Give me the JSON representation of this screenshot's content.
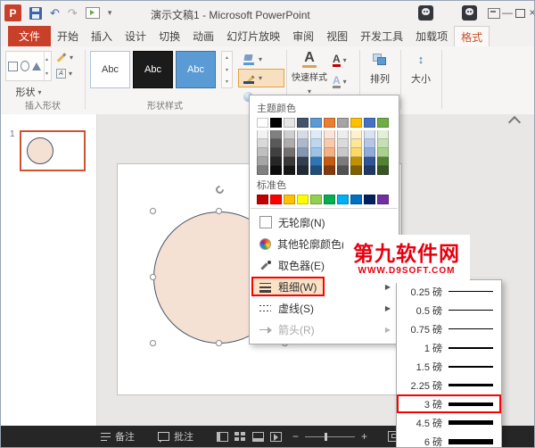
{
  "colors": {
    "file_tab": "#C8402A",
    "annotation": "#FF0000",
    "menu_highlight": "#FBE2C7",
    "circle_fill": "#F5E1D4",
    "circle_stroke": "#44546A",
    "watermark": "#E8000F"
  },
  "icons": {
    "pp_letter": "P",
    "undo": "↶",
    "redo": "↷",
    "dropdown": "▾",
    "submenu_arrow": "▶",
    "gallery_up": "▴",
    "gallery_down": "▾",
    "minimize": "—",
    "close": "×",
    "zoom_out": "−",
    "zoom_in": "+"
  },
  "titlebar": {
    "title": "演示文稿1 - Microsoft PowerPoint"
  },
  "ribbon": {
    "file_tab": "文件",
    "tabs": [
      "开始",
      "插入",
      "设计",
      "切换",
      "动画",
      "幻灯片放映",
      "审阅",
      "视图",
      "开发工具",
      "加载项",
      "格式"
    ],
    "active_tab": "格式",
    "groups": {
      "insert_shapes": {
        "label": "插入形状",
        "shapes_button": "形状"
      },
      "shape_styles": {
        "label": "形状样式",
        "swatches": [
          {
            "label": "Abc",
            "bg": "#FFFFFF",
            "fg": "#3B3B3B",
            "border": "#ABC6E0"
          },
          {
            "label": "Abc",
            "bg": "#1B1B1B",
            "fg": "#FFFFFF",
            "border": "#0A0A0A"
          },
          {
            "label": "Abc",
            "bg": "#5B9BD5",
            "fg": "#FFFFFF",
            "border": "#41719C"
          }
        ]
      },
      "wordart": {
        "quick_styles_label": "快速样式",
        "letter": "A"
      },
      "arrange": {
        "label": "排列"
      },
      "size": {
        "label": "大小"
      }
    }
  },
  "outline_menu": {
    "theme_label": "主题颜色",
    "standard_label": "标准色",
    "theme_colors": [
      "#FFFFFF",
      "#000000",
      "#E7E6E6",
      "#44546A",
      "#5B9BD5",
      "#ED7D31",
      "#A5A5A5",
      "#FFC000",
      "#4472C4",
      "#70AD47"
    ],
    "theme_variants": [
      [
        "#F2F2F2",
        "#808080",
        "#D0CECE",
        "#D6DCE5",
        "#DEEBF7",
        "#FBE5D6",
        "#EDEDED",
        "#FFF2CC",
        "#DAE3F3",
        "#E2F0D9"
      ],
      [
        "#D9D9D9",
        "#595959",
        "#AEABAB",
        "#ACB9CA",
        "#BDD7EE",
        "#F8CBAD",
        "#DBDBDB",
        "#FFE699",
        "#B4C7E7",
        "#C6E0B4"
      ],
      [
        "#BFBFBF",
        "#404040",
        "#757070",
        "#8497B0",
        "#9DC3E6",
        "#F4B183",
        "#C9C9C9",
        "#FFD966",
        "#8FAADC",
        "#A9D18E"
      ],
      [
        "#A6A6A6",
        "#262626",
        "#3A3838",
        "#333F50",
        "#2E75B6",
        "#C55A11",
        "#7B7B7B",
        "#BF9000",
        "#2F5597",
        "#548235"
      ],
      [
        "#808080",
        "#0D0D0D",
        "#161616",
        "#222A35",
        "#1F4E79",
        "#843C0C",
        "#525252",
        "#7F6000",
        "#1F3864",
        "#375623"
      ]
    ],
    "standard_colors": [
      "#C00000",
      "#FF0000",
      "#FFC000",
      "#FFFF00",
      "#92D050",
      "#00B050",
      "#00B0F0",
      "#0070C0",
      "#002060",
      "#7030A0"
    ],
    "items": [
      {
        "id": "no-outline",
        "label": "无轮廓(N)",
        "icon": "no-outline",
        "state": "normal",
        "submenu": false,
        "annotated": false
      },
      {
        "id": "more-outline-colors",
        "label": "其他轮廓颜色(M)...",
        "icon": "color-wheel",
        "state": "normal",
        "submenu": false,
        "annotated": false
      },
      {
        "id": "eyedropper",
        "label": "取色器(E)",
        "icon": "eyedropper",
        "state": "normal",
        "submenu": false,
        "annotated": false
      },
      {
        "id": "weight",
        "label": "粗细(W)",
        "icon": "weight-lines",
        "state": "highlighted",
        "submenu": true,
        "annotated": true
      },
      {
        "id": "dashes",
        "label": "虚线(S)",
        "icon": "dash-lines",
        "state": "normal",
        "submenu": true,
        "annotated": false
      },
      {
        "id": "arrows",
        "label": "箭头(R)",
        "icon": "arrow",
        "state": "disabled",
        "submenu": true,
        "annotated": false
      }
    ]
  },
  "weight_submenu": {
    "items": [
      {
        "label": "0.25 磅",
        "px": 1,
        "annotated": false
      },
      {
        "label": "0.5 磅",
        "px": 1,
        "annotated": false
      },
      {
        "label": "0.75 磅",
        "px": 1,
        "annotated": false
      },
      {
        "label": "1 磅",
        "px": 2,
        "annotated": false
      },
      {
        "label": "1.5 磅",
        "px": 2,
        "annotated": false
      },
      {
        "label": "2.25 磅",
        "px": 3,
        "annotated": false
      },
      {
        "label": "3 磅",
        "px": 4,
        "annotated": true
      },
      {
        "label": "4.5 磅",
        "px": 5,
        "annotated": false
      },
      {
        "label": "6 磅",
        "px": 6,
        "annotated": false
      }
    ]
  },
  "slides_panel": {
    "slide_number": "1"
  },
  "statusbar": {
    "notes": "备注",
    "comments": "批注"
  },
  "watermark": {
    "title": "第九软件网",
    "url": "WWW.D9SOFT.COM"
  }
}
